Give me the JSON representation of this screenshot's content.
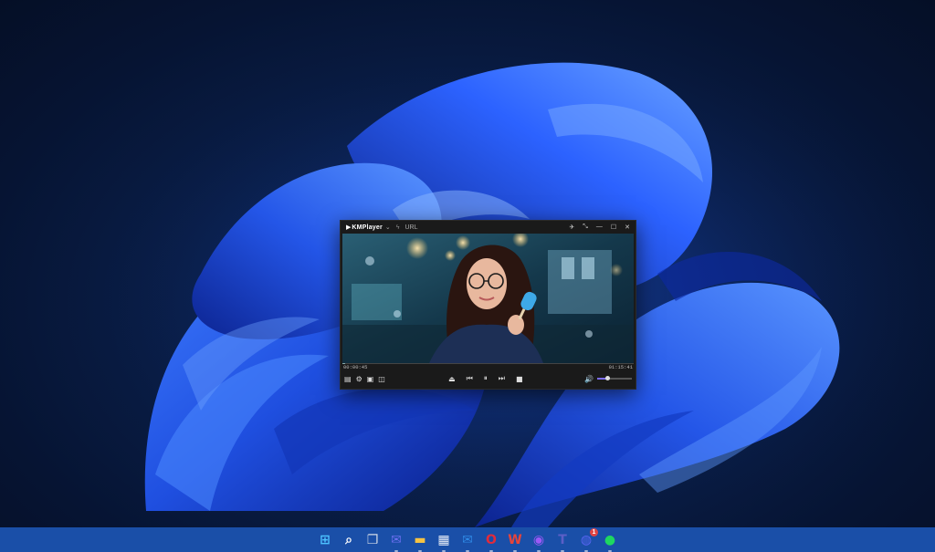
{
  "desktop": {
    "accent": "#1a4fa8"
  },
  "player": {
    "app_name": "KMPlayer",
    "url_label": "URL",
    "elapsed": "00:00:45",
    "total": "01:15:41",
    "progress_fraction": 0.01,
    "volume_fraction": 0.3
  },
  "taskbar": {
    "icons": [
      {
        "name": "start-icon",
        "color": "#4cc2ff"
      },
      {
        "name": "search-icon",
        "color": "#ffffff"
      },
      {
        "name": "task-view-icon",
        "color": "#cfd8e6"
      },
      {
        "name": "chat-icon",
        "color": "#6b6ff0"
      },
      {
        "name": "file-explorer-icon",
        "color": "#f6c343"
      },
      {
        "name": "store-icon",
        "color": "#e9eef7"
      },
      {
        "name": "mail-icon",
        "color": "#2f8ae6"
      },
      {
        "name": "opera-icon",
        "color": "#e12b3c"
      },
      {
        "name": "wps-office-icon",
        "color": "#e8443a"
      },
      {
        "name": "messenger-icon",
        "color": "#9b59f6"
      },
      {
        "name": "teams-icon",
        "color": "#5b5fc7"
      },
      {
        "name": "discord-icon",
        "color": "#5865f2"
      },
      {
        "name": "spotify-icon",
        "color": "#1ed760"
      }
    ],
    "discord_badge": "1"
  }
}
